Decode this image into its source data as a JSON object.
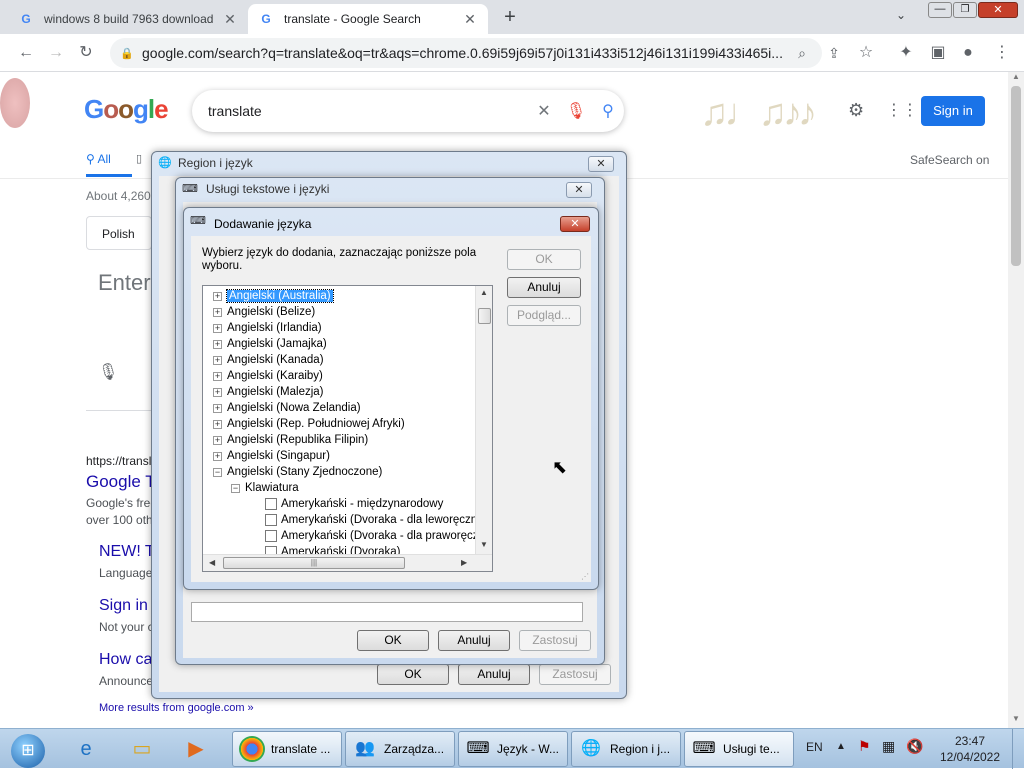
{
  "browser": {
    "tabs": [
      {
        "title": "windows 8 build 7963 download",
        "active": false
      },
      {
        "title": "translate - Google Search",
        "active": true
      }
    ],
    "new_tab_label": "+",
    "url": "google.com/search?q=translate&oq=tr&aqs=chrome.0.69i59j69i57j0i131i433i512j46i131i199i433i465i..."
  },
  "google": {
    "logo": "Google",
    "search_query": "translate",
    "sign_in_label": "Sign in",
    "tab_all_label": "All",
    "safesearch_label": "SafeSearch on",
    "results_count_prefix": "About 4,260",
    "from_language_chip": "Polish",
    "enter_text_partial": "Enter",
    "result_url_partial": "https://transla",
    "result_title_partial": "Google T",
    "result_snippet_1": "Google's free",
    "result_snippet_2": "over 100 othe",
    "sub_new": "NEW! T",
    "sub_new_desc": "Language",
    "sub_signin": "Sign in",
    "sub_signin_desc": "Not your c",
    "sub_how": "How ca",
    "sub_how_desc": "Announce",
    "more_results": "More results from google.com »",
    "colors": {
      "signin_bg": "#1a73e8",
      "link": "#1a0dab"
    }
  },
  "dialog_region": {
    "title": "Region i język",
    "ok_label": "OK",
    "cancel_label": "Anuluj",
    "apply_label": "Zastosuj"
  },
  "dialog_services": {
    "title": "Usługi tekstowe i języki",
    "ok_label": "OK",
    "cancel_label": "Anuluj",
    "apply_label": "Zastosuj"
  },
  "dialog_add": {
    "title": "Dodawanie języka",
    "instruction": "Wybierz język do dodania, zaznaczając poniższe pola wyboru.",
    "ok_label": "OK",
    "cancel_label": "Anuluj",
    "preview_label": "Podgląd...",
    "tree": [
      {
        "label": "Angielski (Australia)",
        "level": 0,
        "toggle": "+",
        "selected": true
      },
      {
        "label": "Angielski (Belize)",
        "level": 0,
        "toggle": "+"
      },
      {
        "label": "Angielski (Irlandia)",
        "level": 0,
        "toggle": "+"
      },
      {
        "label": "Angielski (Jamajka)",
        "level": 0,
        "toggle": "+"
      },
      {
        "label": "Angielski (Kanada)",
        "level": 0,
        "toggle": "+"
      },
      {
        "label": "Angielski (Karaiby)",
        "level": 0,
        "toggle": "+"
      },
      {
        "label": "Angielski (Malezja)",
        "level": 0,
        "toggle": "+"
      },
      {
        "label": "Angielski (Nowa Zelandia)",
        "level": 0,
        "toggle": "+"
      },
      {
        "label": "Angielski (Rep. Południowej Afryki)",
        "level": 0,
        "toggle": "+"
      },
      {
        "label": "Angielski (Republika Filipin)",
        "level": 0,
        "toggle": "+"
      },
      {
        "label": "Angielski (Singapur)",
        "level": 0,
        "toggle": "+"
      },
      {
        "label": "Angielski (Stany Zjednoczone)",
        "level": 0,
        "toggle": "-"
      },
      {
        "label": "Klawiatura",
        "level": 1,
        "toggle": "-"
      },
      {
        "label": "Amerykański - międzynarodowy",
        "level": 2,
        "checkbox": true
      },
      {
        "label": "Amerykański (Dvoraka - dla leworęcznych)",
        "level": 2,
        "checkbox": true
      },
      {
        "label": "Amerykański (Dvoraka - dla praworęcznych)",
        "level": 2,
        "checkbox": true
      },
      {
        "label": "Amerykański (Dvoraka)",
        "level": 2,
        "checkbox": true
      }
    ]
  },
  "taskbar": {
    "items": [
      {
        "label": "translate ...",
        "icon": "chrome-icon"
      },
      {
        "label": "Zarządza...",
        "icon": "users-icon"
      },
      {
        "label": "Język - W...",
        "icon": "keyboard-icon"
      },
      {
        "label": "Region i j...",
        "icon": "globe-icon"
      },
      {
        "label": "Usługi te...",
        "icon": "services-icon"
      }
    ],
    "lang": "EN",
    "time": "23:47",
    "date": "12/04/2022"
  }
}
